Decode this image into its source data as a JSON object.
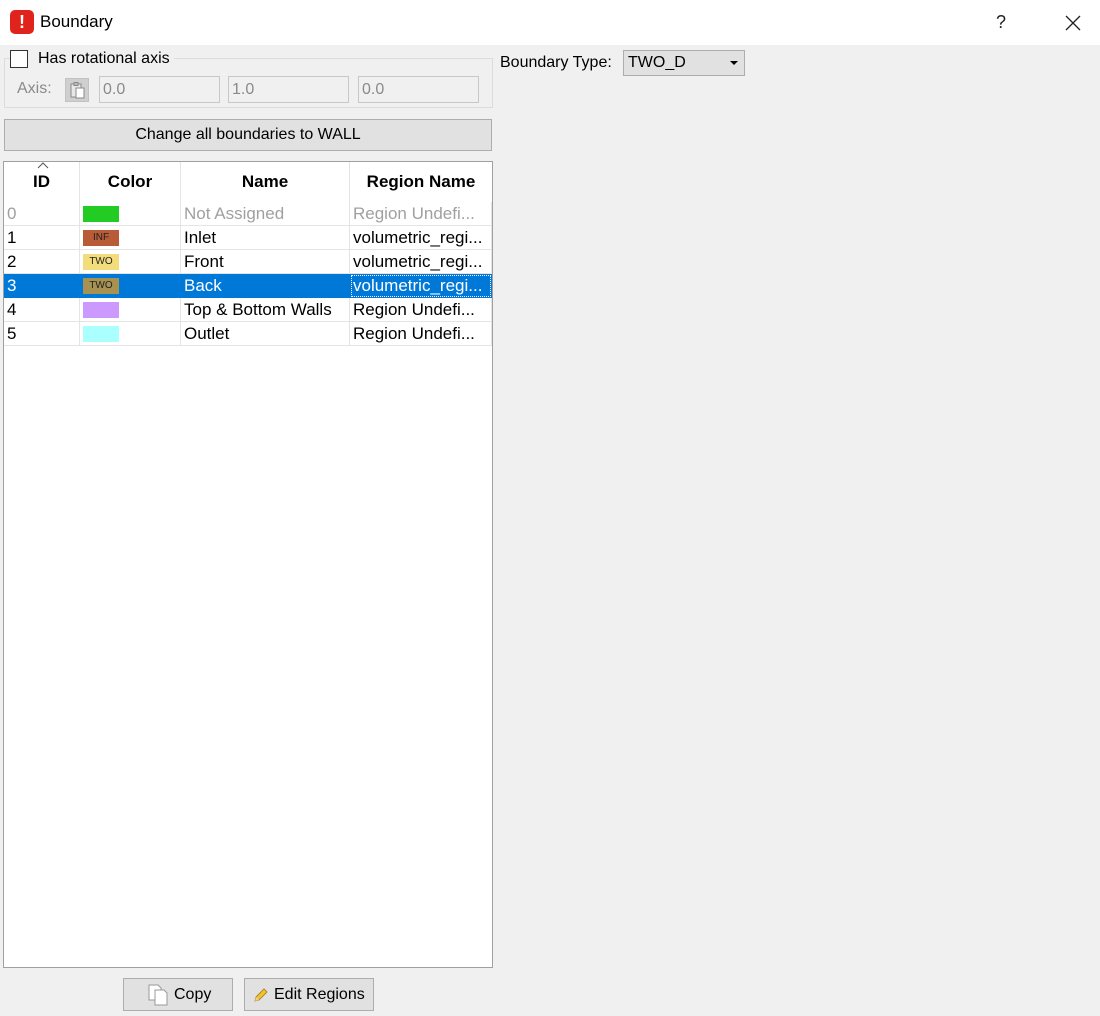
{
  "window": {
    "title": "Boundary",
    "help_label": "?",
    "icon": "exclamation-icon"
  },
  "axis": {
    "checkbox_label": "Has rotational axis",
    "checked": false,
    "axis_label": "Axis:",
    "x": "0.0",
    "y": "1.0",
    "z": "0.0"
  },
  "boundary_type": {
    "label": "Boundary Type:",
    "value": "TWO_D"
  },
  "change_all_label": "Change all boundaries to WALL",
  "table": {
    "columns": [
      "ID",
      "Color",
      "Name",
      "Region Name"
    ],
    "rows": [
      {
        "id": "0",
        "color": "#22cc22",
        "badge": "",
        "name": "Not Assigned",
        "region": "Region Undefi...",
        "state": "dim"
      },
      {
        "id": "1",
        "color": "#b85c38",
        "badge": "INF",
        "name": "Inlet",
        "region": "volumetric_regi...",
        "state": "normal"
      },
      {
        "id": "2",
        "color": "#f2dc7c",
        "badge": "TWO",
        "name": "Front",
        "region": "volumetric_regi...",
        "state": "normal"
      },
      {
        "id": "3",
        "color": "#a89252",
        "badge": "TWO",
        "name": "Back",
        "region": "volumetric_regi...",
        "state": "selected"
      },
      {
        "id": "4",
        "color": "#cc99ff",
        "badge": "",
        "name": "Top & Bottom Walls",
        "region": "Region Undefi...",
        "state": "normal"
      },
      {
        "id": "5",
        "color": "#aaffff",
        "badge": "",
        "name": "Outlet",
        "region": "Region Undefi...",
        "state": "normal"
      }
    ]
  },
  "buttons": {
    "copy": "Copy",
    "edit_regions": "Edit Regions"
  }
}
